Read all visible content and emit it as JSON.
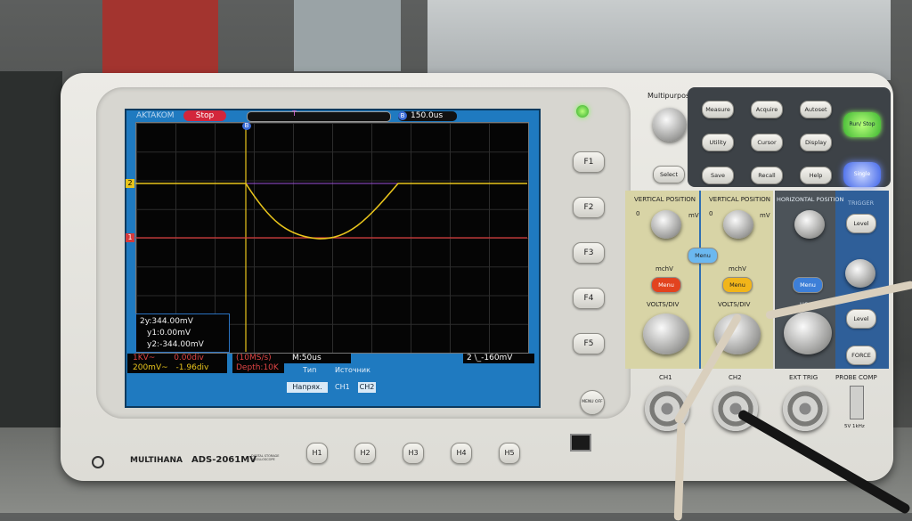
{
  "screen": {
    "brand": "AKTAKOM",
    "run_state": "Stop",
    "trigger_marker": "T",
    "timebase_icon": "B",
    "horizontal_position": "150.0us",
    "ch2_marker": "2",
    "ch1_marker": "1",
    "trigger_cursor_marker": "B",
    "cursors": {
      "dy": "2y:344.00mV",
      "y1": "y1:0.00mV",
      "y2": "y2:-344.00mV"
    },
    "ch1_status": "1KV~",
    "ch1_offset": "0.00div",
    "ch2_status": "200mV~",
    "ch2_offset": "-1.96div",
    "sample_rate": "(10MS/s)",
    "depth": "Depth:10K",
    "timebase": "M:50us",
    "trigger_status": "2 \\_-160mV",
    "menu": {
      "type_label": "Тип",
      "type_value": "Напрях.",
      "source_label": "Источник",
      "source_ch1": "CH1",
      "source_ch2": "CH2"
    },
    "colors": {
      "ch1": "#d63a3a",
      "ch2": "#e8c41c",
      "cursor": "#9a4ed8",
      "screen_border": "#1f7ac0"
    }
  },
  "side_buttons": [
    "F1",
    "F2",
    "F3",
    "F4",
    "F5"
  ],
  "bottom_buttons": [
    "H1",
    "H2",
    "H3",
    "H4",
    "H5"
  ],
  "power_label": "MENU OFF",
  "branding": {
    "logo": "MULTIHANA",
    "model": "ADS-2061MV",
    "subtitle": "DIGITAL STORAGE OSCILLOSCOPE"
  },
  "controls": {
    "multipurpose": "Multipurpose",
    "select": "Select",
    "keys": [
      "Measure",
      "Acquire",
      "Autoset",
      "Utility",
      "Cursor",
      "Display",
      "Save",
      "Recall",
      "Help"
    ],
    "run_stop": "Run/ Stop",
    "single": "Single",
    "vertical_position_1": "VERTICAL POSITION",
    "vertical_position_2": "VERTICAL POSITION",
    "horizontal_position": "HORIZONTAL POSITION",
    "trigger": "TRIGGER",
    "level": "Level",
    "level2": "Level",
    "force": "FORCE",
    "math_menu": "Menu",
    "ch1_menu": "Menu",
    "ch2_menu": "Menu",
    "horiz_menu": "Menu",
    "mchv_1": "mchV",
    "mchv_2": "mchV",
    "volts_div_1": "VOLTS/DIV",
    "volts_div_2": "VOLTS/DIV",
    "zero_1": "0",
    "zero_2": "0",
    "mv_1": "mV",
    "mv_2": "mV",
    "horiz_label": "HORI",
    "ch1": "CH1",
    "ch2": "CH2",
    "ext_trig": "EXT TRIG",
    "probe_comp": "PROBE COMP",
    "probe_comp_spec": "5V 1kHz"
  }
}
